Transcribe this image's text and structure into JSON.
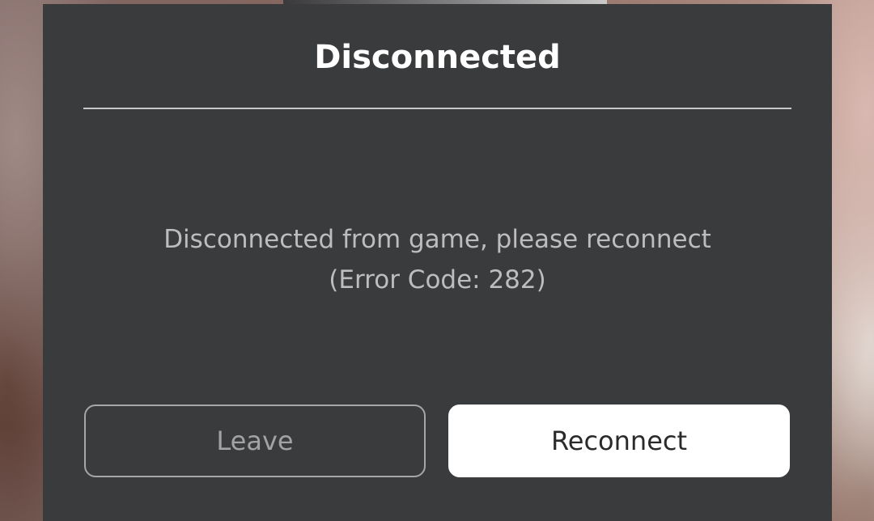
{
  "dialog": {
    "title": "Disconnected",
    "message_line1": "Disconnected from game, please reconnect",
    "message_line2": "(Error Code: 282)",
    "buttons": {
      "leave_label": "Leave",
      "reconnect_label": "Reconnect"
    }
  },
  "colors": {
    "dialog_background": "#3a3b3d",
    "title_text": "#ffffff",
    "message_text": "#bdbdbd",
    "secondary_button_border": "#a6a6a6",
    "primary_button_background": "#ffffff"
  }
}
